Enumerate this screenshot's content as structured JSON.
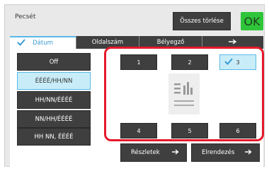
{
  "header": {
    "title": "Pecsét",
    "clear_label": "Összes törlése",
    "ok_label": "OK"
  },
  "tabs": [
    {
      "label": "Dátum",
      "active": true
    },
    {
      "label": "Oldalszám",
      "active": false
    },
    {
      "label": "Bélyegző",
      "active": false
    },
    {
      "label": "",
      "icon": "arrow-right-icon",
      "active": false
    }
  ],
  "formats": [
    {
      "label": "Off",
      "selected": false
    },
    {
      "label": "ÉÉÉÉ/HH/NN",
      "selected": true
    },
    {
      "label": "HH/NN/ÉÉÉÉ",
      "selected": false
    },
    {
      "label": "NN/HH/ÉÉÉÉ",
      "selected": false
    },
    {
      "label": "HH NN, ÉÉÉÉ",
      "selected": false
    }
  ],
  "positions": [
    {
      "label": "1",
      "selected": false
    },
    {
      "label": "2",
      "selected": false
    },
    {
      "label": "3",
      "selected": true
    },
    {
      "label": "4",
      "selected": false
    },
    {
      "label": "5",
      "selected": false
    },
    {
      "label": "6",
      "selected": false
    }
  ],
  "footer": {
    "details_label": "Részletek",
    "layout_label": "Elrendezés"
  },
  "colors": {
    "ok_green": "#2fc53a",
    "accent_blue": "#58b9e8",
    "highlight_red": "#e5192b",
    "button_dark": "#3f3f3f"
  }
}
